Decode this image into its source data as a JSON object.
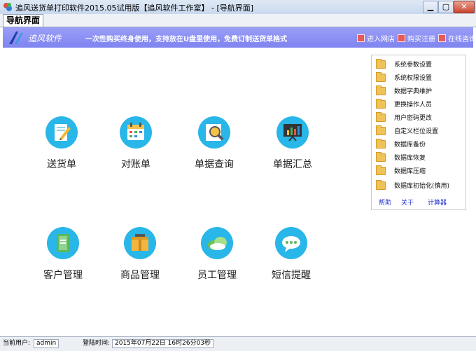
{
  "window": {
    "title": "追风送货单打印软件2015.05试用版【追风软件工作室】 - [导航界面]",
    "min_label": "▁",
    "max_label": "▢",
    "close_label": "✕"
  },
  "tabs": [
    {
      "label": "导航界面"
    }
  ],
  "banner": {
    "logo_text": "追风软件",
    "slogan": "一次性购买终身使用，支持放在U盘里使用，免费订制送货单格式",
    "links": [
      {
        "label": "进入网店",
        "icon": "shop-icon"
      },
      {
        "label": "购买注册",
        "icon": "register-icon"
      },
      {
        "label": "在线咨询",
        "icon": "chat-icon"
      }
    ]
  },
  "modules": [
    {
      "label": "送货单",
      "icon": "pencil-note-icon",
      "color": "#29b6e8"
    },
    {
      "label": "对账单",
      "icon": "calendar-icon",
      "color": "#29b6e8"
    },
    {
      "label": "单据查询",
      "icon": "magnifier-icon",
      "color": "#29b6e8"
    },
    {
      "label": "单据汇总",
      "icon": "presentation-chart-icon",
      "color": "#29b6e8"
    },
    {
      "label": "客户管理",
      "icon": "address-book-icon",
      "color": "#29b6e8"
    },
    {
      "label": "商品管理",
      "icon": "package-box-icon",
      "color": "#29b6e8"
    },
    {
      "label": "员工管理",
      "icon": "cloud-icon",
      "color": "#29b6e8"
    },
    {
      "label": "短信提醒",
      "icon": "message-bubble-icon",
      "color": "#29b6e8"
    }
  ],
  "settings_menu": {
    "items": [
      {
        "label": "系统参数设置"
      },
      {
        "label": "系统权限设置"
      },
      {
        "label": "数据字典维护"
      },
      {
        "label": "更换操作人员"
      },
      {
        "label": "用户密码更改"
      },
      {
        "label": "自定义栏位设置"
      },
      {
        "label": "数据库备份"
      },
      {
        "label": "数据库恢复"
      },
      {
        "label": "数据库压缩"
      },
      {
        "label": "数据库初始化(慎用)"
      }
    ],
    "links": [
      {
        "label": "帮助"
      },
      {
        "label": "关于"
      },
      {
        "label": "计算器"
      }
    ]
  },
  "statusbar": {
    "user_label": "当前用户:",
    "user_value": "admin",
    "login_label": "登陆时间:",
    "login_value": "2015年07月22日 16时26分03秒"
  },
  "colors": {
    "banner": "#8a8ef2",
    "icon_circle": "#29b6e8",
    "link": "#2233cc"
  }
}
